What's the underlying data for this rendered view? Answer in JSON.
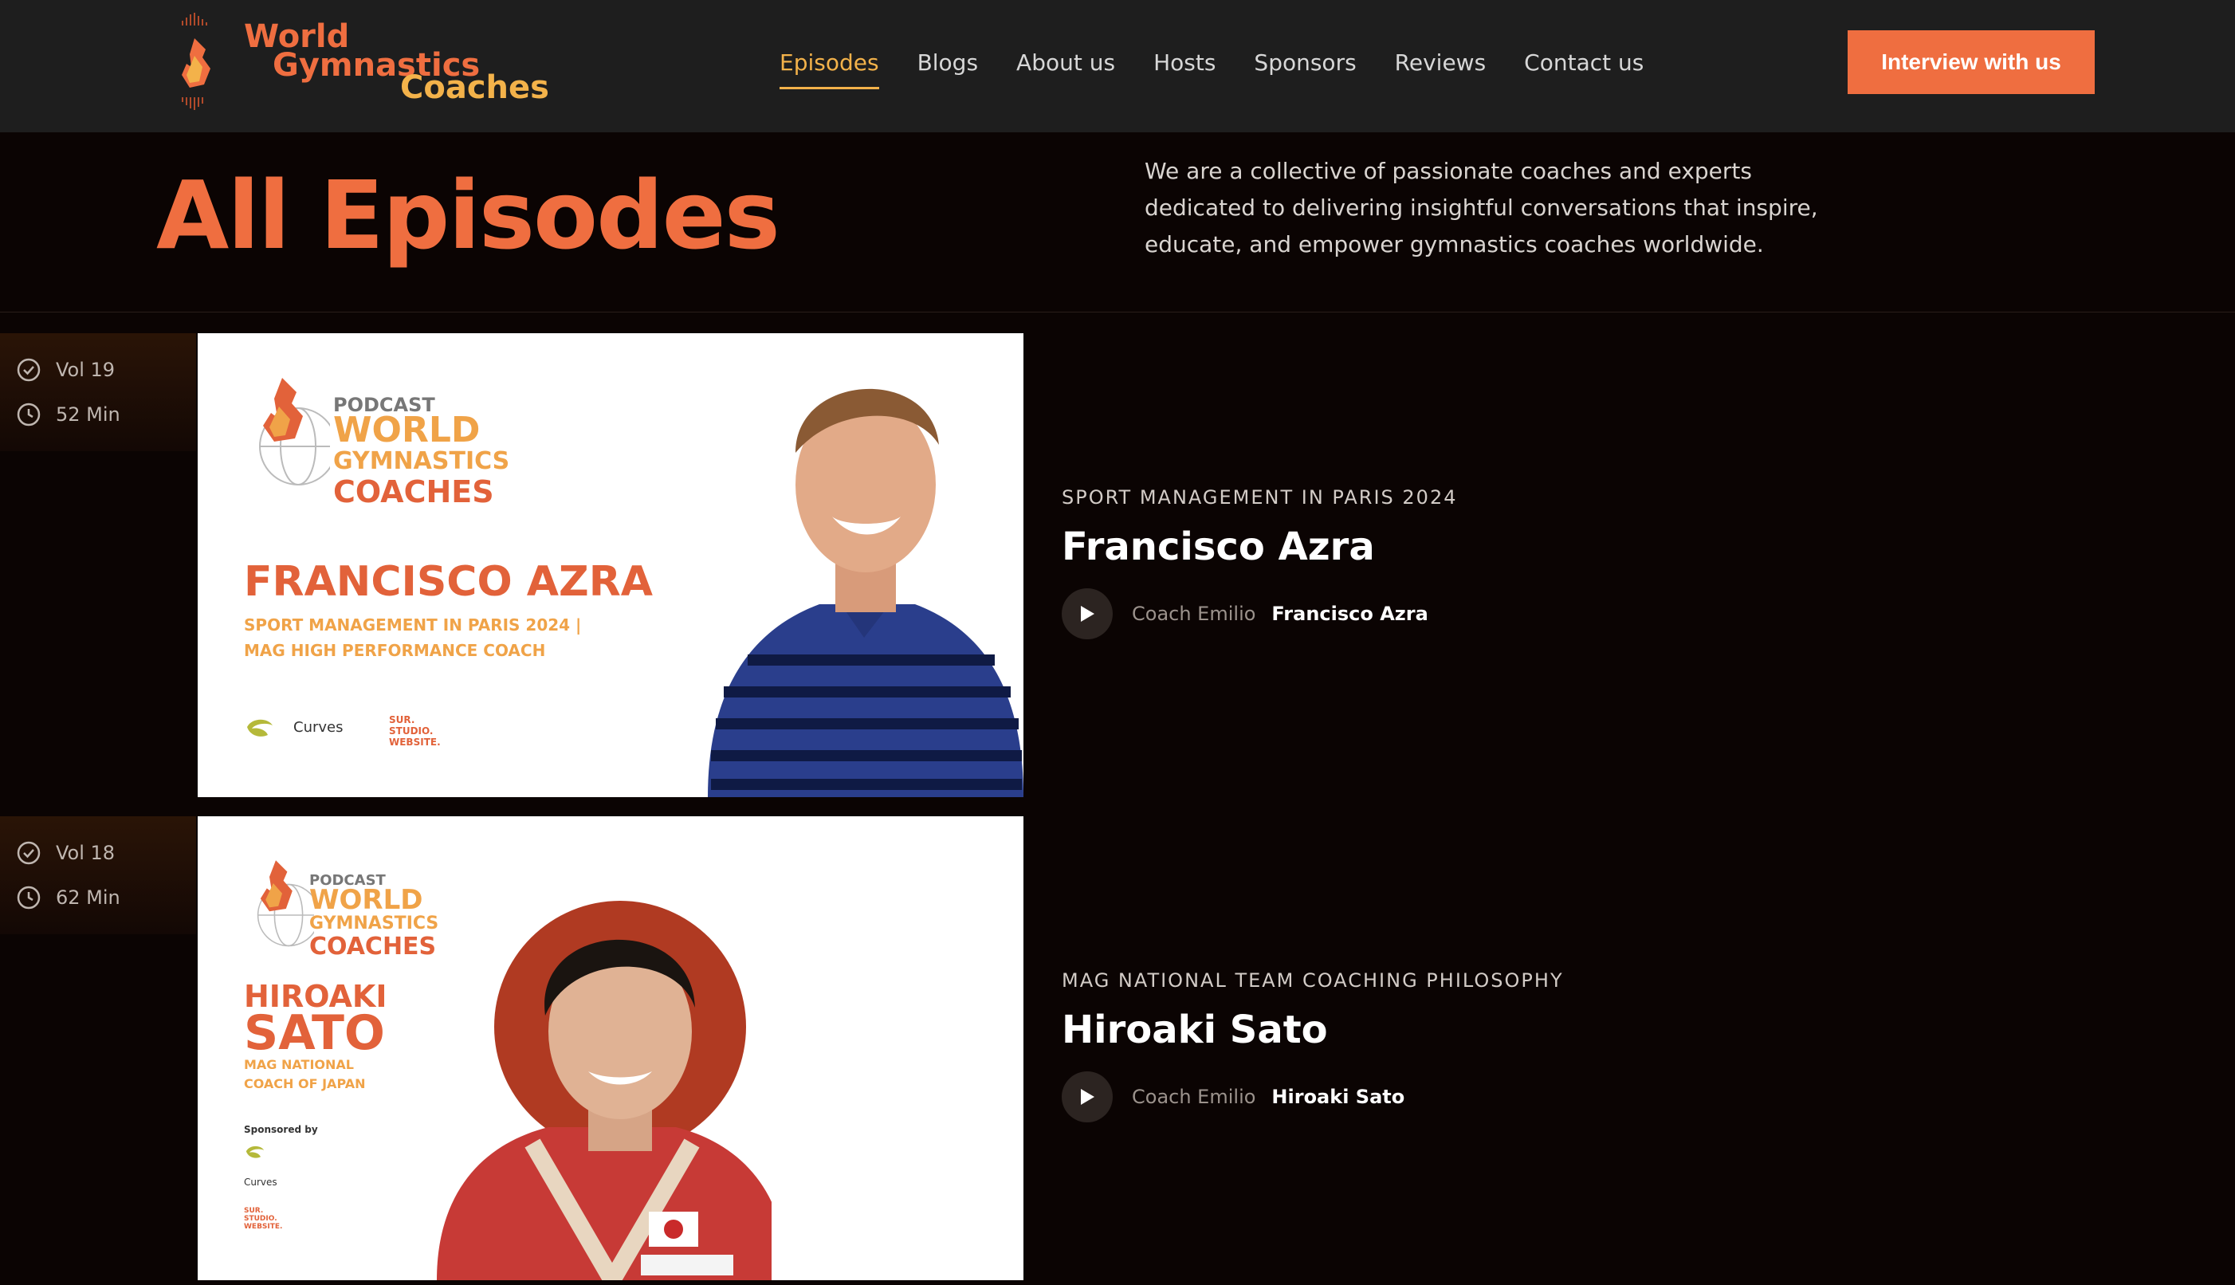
{
  "brand": {
    "line1": "World",
    "line2": "Gymnastics",
    "line3": "Coaches"
  },
  "nav": {
    "items": [
      "Episodes",
      "Blogs",
      "About us",
      "Hosts",
      "Sponsors",
      "Reviews",
      "Contact us"
    ],
    "active": "Episodes"
  },
  "cta": {
    "label": "Interview with us"
  },
  "hero": {
    "title": "All Episodes",
    "description": "We are a collective of passionate coaches and experts dedicated to delivering insightful conversations that inspire, educate, and empower gymnastics coaches worldwide."
  },
  "episodes": [
    {
      "vol": "Vol 19",
      "duration": "52 Min",
      "category": "SPORT MANAGEMENT IN PARIS 2024",
      "title": "Francisco Azra",
      "host": "Coach Emilio",
      "guest": "Francisco Azra",
      "thumb": {
        "podcast": "PODCAST",
        "logo_l1": "WORLD",
        "logo_l2": "GYMNASTICS",
        "logo_l3": "COACHES",
        "name": "FRANCISCO AZRA",
        "sub1": "SPORT MANAGEMENT IN PARIS 2024 |",
        "sub2": "MAG HIGH PERFORMANCE COACH",
        "sponsors": [
          "Curves",
          "SUR. STUDIO. WEBSITE."
        ]
      }
    },
    {
      "vol": "Vol 18",
      "duration": "62 Min",
      "category": "MAG NATIONAL TEAM COACHING PHILOSOPHY",
      "title": "Hiroaki Sato",
      "host": "Coach Emilio",
      "guest": "Hiroaki Sato",
      "thumb": {
        "podcast": "PODCAST",
        "logo_l1": "WORLD",
        "logo_l2": "GYMNASTICS",
        "logo_l3": "COACHES",
        "name1": "HIROAKI",
        "name2": "SATO",
        "sub1": "MAG NATIONAL",
        "sub2": "COACH OF JAPAN",
        "sponsored_by": "Sponsored by",
        "sponsors": [
          "Curves",
          "SUR. STUDIO. WEBSITE."
        ]
      }
    }
  ],
  "colors": {
    "accent": "#ef6e40",
    "gold": "#f3b24a",
    "header_bg": "#1e1e1e",
    "page_bg": "#0b0403"
  }
}
